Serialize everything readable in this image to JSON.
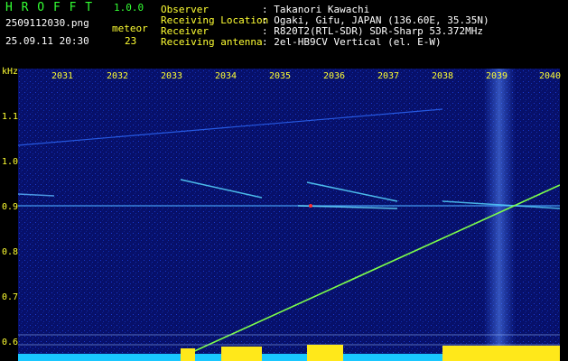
{
  "header": {
    "logo": "H R O F F T",
    "version": "1.0.0",
    "filename": "2509112030.png",
    "datetime": "25.09.11 20:30",
    "meteor_label": "meteor",
    "meteor_count": "23",
    "info_keys": [
      "Observer",
      "Receiving Location",
      "Receiver",
      "Receiving antenna"
    ],
    "info_vals": [
      ": Takanori Kawachi",
      ": Ogaki, Gifu, JAPAN (136.60E, 35.35N)",
      ": R820T2(RTL-SDR) SDR-Sharp 53.372MHz",
      ": 2el-HB9CV Vertical (el. E-W)"
    ]
  },
  "axis": {
    "unit": "kHz",
    "x_ticks": [
      "2031",
      "2032",
      "2033",
      "2034",
      "2035",
      "2036",
      "2037",
      "2038",
      "2039",
      "2040"
    ],
    "y_ticks": [
      "1.1",
      "1.0",
      "0.9",
      "0.8",
      "0.7",
      "0.6"
    ]
  },
  "colors": {
    "background": "#000000",
    "spectrogram": "#07106a",
    "text_primary": "#ffff33",
    "text_accent": "#33ff33",
    "meteor_trace": "#7dff4a",
    "noise_bars": "#ffe81a",
    "baseline": "#19c8ff"
  }
}
